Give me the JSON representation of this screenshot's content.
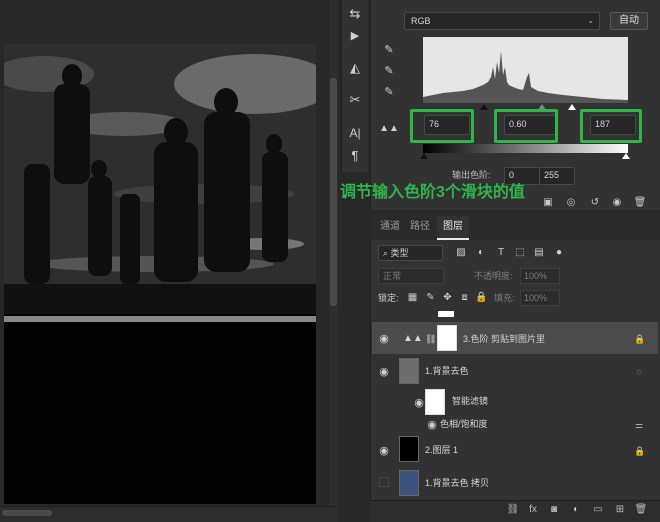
{
  "canvas": {
    "image": "black-and-white-silhouette-photo"
  },
  "tools": [
    {
      "name": "history-icon",
      "glyph": "⇆"
    },
    {
      "name": "play-icon",
      "glyph": "▶"
    },
    {
      "name": "shape-icon",
      "glyph": "◭"
    },
    {
      "name": "scissors-icon",
      "glyph": "✂"
    },
    {
      "name": "character-icon",
      "glyph": "A|"
    },
    {
      "name": "paragraph-icon",
      "glyph": "¶"
    }
  ],
  "properties": {
    "levels_icon": "levels-icon",
    "channel": "RGB",
    "auto_label": "自动",
    "input_levels": {
      "black": "76",
      "gamma": "0.60",
      "white": "187"
    },
    "output_label": "输出色阶:",
    "output_levels": {
      "black": "0",
      "white": "255"
    },
    "annotation": "调节输入色阶3个滑块的值",
    "highlight_color": "#2fb54a"
  },
  "layers_panel": {
    "tabs": [
      {
        "label": "通道",
        "active": false
      },
      {
        "label": "路径",
        "active": false
      },
      {
        "label": "图层",
        "active": true
      }
    ],
    "filter_kind": "类型",
    "blend_mode": "正常",
    "opacity_label": "不透明度:",
    "opacity_value": "100%",
    "lock_label": "锁定:",
    "fill_label": "填充:",
    "fill_value": "100%",
    "layers": [
      {
        "name": "3.色阶 剪贴到图片里",
        "selected": true
      },
      {
        "name": "1.背景去色",
        "selected": false
      },
      {
        "name": "智能滤镜",
        "selected": false
      },
      {
        "name": "色相/饱和度",
        "selected": false
      },
      {
        "name": "2.图层 1",
        "selected": false
      },
      {
        "name": "1.背景去色 拷贝",
        "selected": false
      }
    ]
  }
}
